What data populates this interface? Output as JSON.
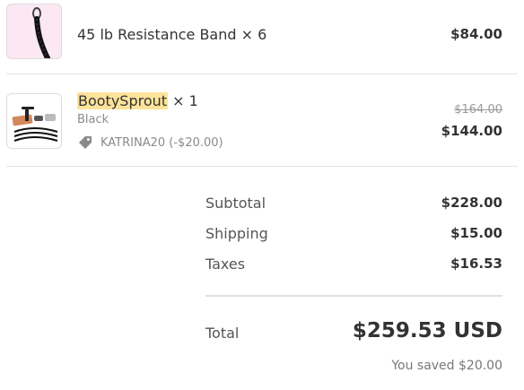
{
  "items": [
    {
      "title": "45 lb Resistance Band",
      "qty": "× 6",
      "price": "$84.00",
      "image_icon": "resistance-band-icon"
    },
    {
      "title": "BootySprout",
      "qty": "× 1",
      "variant": "Black",
      "discount_code": "KATRINA20 (-$20.00)",
      "original_price": "$164.00",
      "price": "$144.00",
      "image_icon": "booty-sprout-product-icon"
    }
  ],
  "summary": {
    "subtotal_label": "Subtotal",
    "subtotal_value": "$228.00",
    "shipping_label": "Shipping",
    "shipping_value": "$15.00",
    "taxes_label": "Taxes",
    "taxes_value": "$16.53",
    "total_label": "Total",
    "total_value": "$259.53 USD",
    "saved_text": "You saved $20.00"
  },
  "colors": {
    "highlight": "#fde39a",
    "thumb_pink": "#fbe8f3"
  }
}
